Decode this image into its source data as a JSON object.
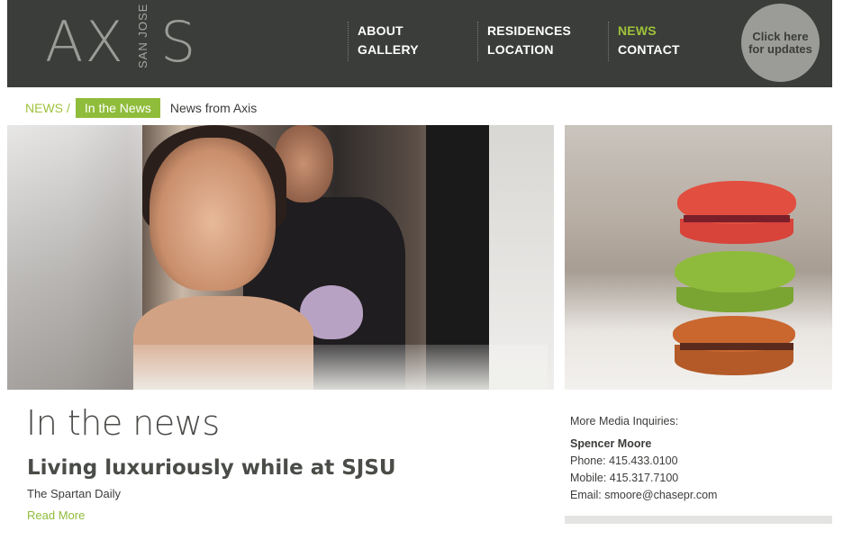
{
  "header": {
    "logo": {
      "left": "AX",
      "vertical": "SAN JOSE",
      "right": "S"
    },
    "nav": {
      "col1": [
        "ABOUT",
        "GALLERY"
      ],
      "col2": [
        "RESIDENCES",
        "LOCATION"
      ],
      "col3": [
        "NEWS",
        "CONTACT"
      ]
    },
    "active_nav": "NEWS",
    "cta": {
      "line1": "Click here",
      "line2": "for updates"
    }
  },
  "breadcrumb": {
    "root": "NEWS",
    "separator": "/",
    "active": "In the News",
    "tail": "News from Axis"
  },
  "main": {
    "page_title": "In the news",
    "article": {
      "title": "Living luxuriously while at SJSU",
      "source": "The Spartan Daily",
      "read_more": "Read More"
    }
  },
  "sidebar": {
    "label": "More Media Inquiries:",
    "contact_name": "Spencer Moore",
    "phone": "Phone: 415.433.0100",
    "mobile": "Mobile: 415.317.7100",
    "email": "Email: smoore@chasepr.com"
  },
  "colors": {
    "header_bg": "#3b3d3a",
    "accent_green": "#8fbc3a",
    "cta_bg": "#9b9c98"
  }
}
